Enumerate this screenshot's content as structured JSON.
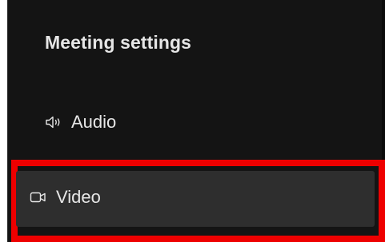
{
  "panel": {
    "title": "Meeting settings",
    "items": [
      {
        "label": "Audio",
        "icon": "speaker-icon",
        "selected": false
      },
      {
        "label": "Video",
        "icon": "video-camera-icon",
        "selected": true
      }
    ]
  },
  "colors": {
    "panel_bg": "#141414",
    "selected_bg": "#2e2e2e",
    "highlight_border": "#ee0000",
    "text": "#e6e6e6"
  }
}
